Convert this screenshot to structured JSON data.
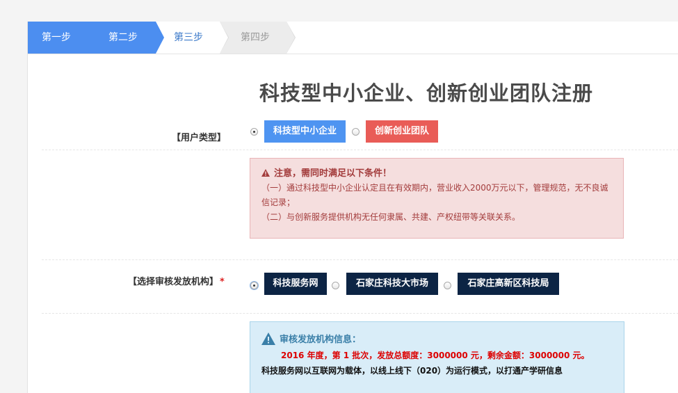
{
  "steps": [
    {
      "label": "第一步",
      "state": "done"
    },
    {
      "label": "第二步",
      "state": "done"
    },
    {
      "label": "第三步",
      "state": "current"
    },
    {
      "label": "第四步",
      "state": "pending"
    }
  ],
  "page_title": "科技型中小企业、创新创业团队注册",
  "user_type": {
    "label": "【用户类型】",
    "options": [
      {
        "label": "科技型中小企业",
        "selected": true,
        "color": "#4e94f1"
      },
      {
        "label": "创新创业团队",
        "selected": false,
        "color": "#e95c57"
      }
    ]
  },
  "notice": {
    "heading": "注意，需同时满足以下条件！",
    "line1": "（一）通过科技型中小企业认定且在有效期内，营业收入2000万元以下，管理规范，无不良诚信记录；",
    "line2": "（二）与创新服务提供机构无任何隶属、共建、产权纽带等关联关系。"
  },
  "issuer": {
    "label": "【选择审核发放机构】",
    "required_mark": "*",
    "options": [
      {
        "label": "科技服务网",
        "selected": true
      },
      {
        "label": "石家庄科技大市场",
        "selected": false
      },
      {
        "label": "石家庄高新区科技局",
        "selected": false
      }
    ]
  },
  "issuer_info": {
    "heading": "审核发放机构信息：",
    "quota": "2016 年度，第 1 批次，发放总额度：3000000 元，剩余金额：3000000 元。",
    "description": "科技服务网以互联网为载体，以线上线下（020）为运行模式，以打通产学研信息"
  },
  "colors": {
    "step_active": "#4c8ef0",
    "tag_navy": "#0c2444",
    "alert_red_bg": "#f5dede",
    "alert_blue_bg": "#d9edf8"
  }
}
